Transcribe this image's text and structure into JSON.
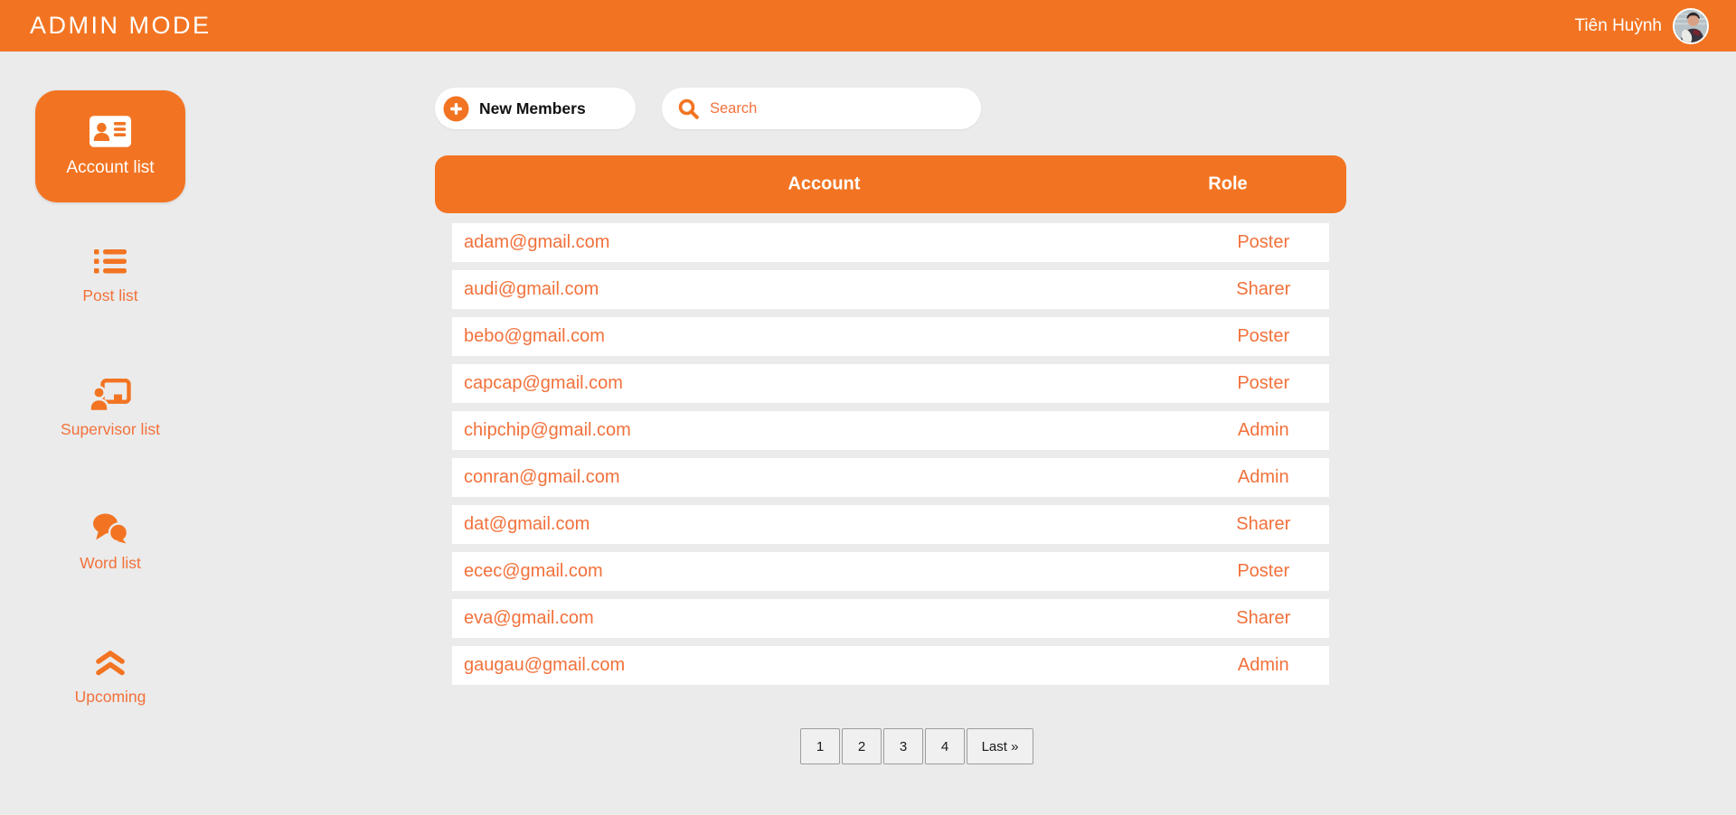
{
  "header": {
    "title": "ADMIN MODE",
    "user_name": "Tiên Huỳnh"
  },
  "sidebar": {
    "items": [
      {
        "label": "Account list",
        "icon": "address-card-icon",
        "active": true
      },
      {
        "label": "Post list",
        "icon": "list-icon",
        "active": false
      },
      {
        "label": "Supervisor list",
        "icon": "person-chalkboard-icon",
        "active": false
      },
      {
        "label": "Word list",
        "icon": "comments-icon",
        "active": false
      },
      {
        "label": "Upcoming",
        "icon": "angles-up-icon",
        "active": false
      }
    ]
  },
  "toolbar": {
    "new_members_label": "New Members",
    "search_placeholder": "Search",
    "search_value": ""
  },
  "table": {
    "columns": [
      "Account",
      "Role"
    ],
    "rows": [
      {
        "account": "adam@gmail.com",
        "role": "Poster"
      },
      {
        "account": "audi@gmail.com",
        "role": "Sharer"
      },
      {
        "account": "bebo@gmail.com",
        "role": "Poster"
      },
      {
        "account": "capcap@gmail.com",
        "role": "Poster"
      },
      {
        "account": "chipchip@gmail.com",
        "role": "Admin"
      },
      {
        "account": "conran@gmail.com",
        "role": "Admin"
      },
      {
        "account": "dat@gmail.com",
        "role": "Sharer"
      },
      {
        "account": "ecec@gmail.com",
        "role": "Poster"
      },
      {
        "account": "eva@gmail.com",
        "role": "Sharer"
      },
      {
        "account": "gaugau@gmail.com",
        "role": "Admin"
      }
    ]
  },
  "pagination": {
    "pages": [
      "1",
      "2",
      "3",
      "4"
    ],
    "last_label": "Last »"
  },
  "colors": {
    "accent": "#F27422",
    "text_orange": "#F2713B",
    "background": "#EBEBEB",
    "white": "#FFFFFF"
  }
}
